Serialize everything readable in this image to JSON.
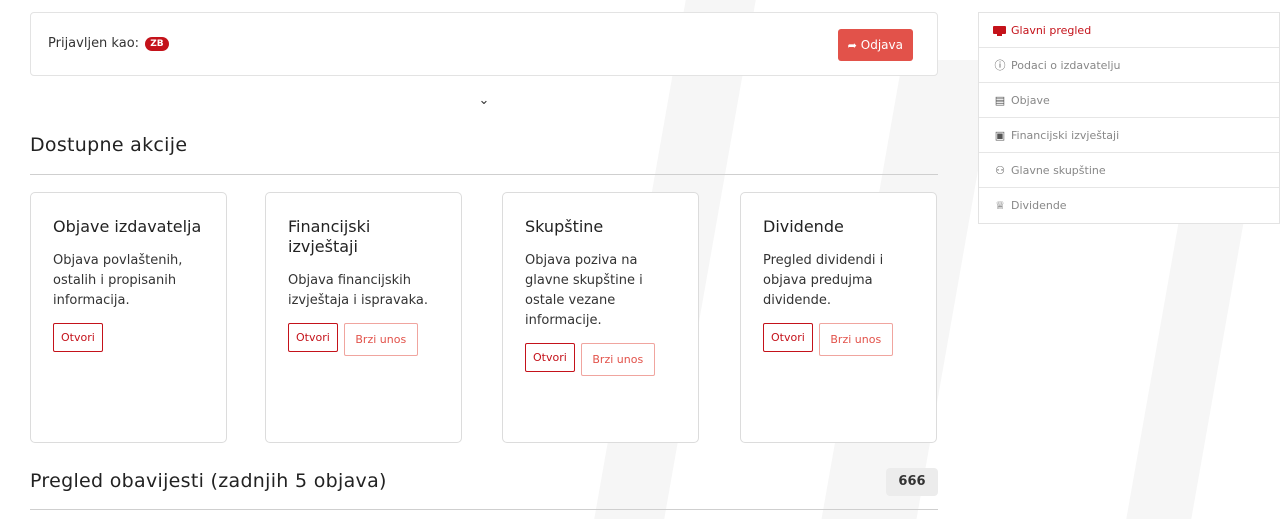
{
  "header": {
    "login_label": "Prijavljen kao:",
    "user_badge": "ZB",
    "logout_label": "Odjava",
    "logout_icon": "sign-out-icon"
  },
  "toggle_icon": "chevron-down-icon",
  "actions_section": {
    "title": "Dostupne akcije",
    "cards": [
      {
        "title": "Objave izdavatelja",
        "description": "Objava povlaštenih, ostalih i propisanih informacija.",
        "open_label": "Otvori"
      },
      {
        "title": "Financijski izvještaji",
        "description": "Objava financijskih izvještaja i ispravaka.",
        "open_label": "Otvori",
        "quick_label": "Brzi unos"
      },
      {
        "title": "Skupštine",
        "description": "Objava poziva na glavne skupštine i ostale vezane informacije.",
        "open_label": "Otvori",
        "quick_label": "Brzi unos"
      },
      {
        "title": "Dividende",
        "description": "Pregled dividendi i objava predujma dividende.",
        "open_label": "Otvori",
        "quick_label": "Brzi unos"
      }
    ]
  },
  "notifications_section": {
    "title": "Pregled obavijesti (zadnjih 5 objava)",
    "count": "666"
  },
  "sidebar": {
    "items": [
      {
        "label": "Glavni pregled",
        "icon": "monitor-icon",
        "active": true
      },
      {
        "label": "Podaci o izdavatelju",
        "icon": "info-circle-icon"
      },
      {
        "label": "Objave",
        "icon": "newspaper-icon"
      },
      {
        "label": "Financijski izvještaji",
        "icon": "clipboard-icon"
      },
      {
        "label": "Glavne skupštine",
        "icon": "users-icon"
      },
      {
        "label": "Dividende",
        "icon": "trophy-icon"
      }
    ]
  },
  "colors": {
    "brand_red": "#c4121a",
    "button_red": "#e2524a"
  }
}
